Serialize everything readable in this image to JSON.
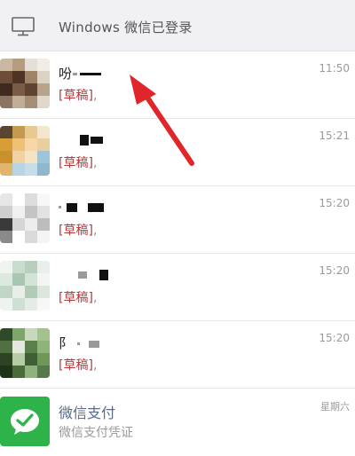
{
  "banner": {
    "text": "Windows 微信已登录",
    "icon": "monitor-icon"
  },
  "chats": [
    {
      "name": "吩",
      "time": "11:50",
      "draft": "[草稿]",
      "suffix": ","
    },
    {
      "name": "",
      "time": "15:21",
      "draft": "[草稿]",
      "suffix": ","
    },
    {
      "name": "",
      "time": "15:20",
      "draft": "[草稿]",
      "suffix": ","
    },
    {
      "name": "",
      "time": "15:20",
      "draft": "[草稿]",
      "suffix": ","
    },
    {
      "name": "阝",
      "time": "15:20",
      "draft": "[草稿]",
      "suffix": ","
    }
  ],
  "pay": {
    "name": "微信支付",
    "time": "星期六",
    "preview": "微信支付凭证",
    "icon": "wechat-pay-icon"
  },
  "colors": {
    "draft_red": "#b43a3a",
    "arrow_red": "#e0262a",
    "pay_green": "#2db34a"
  }
}
